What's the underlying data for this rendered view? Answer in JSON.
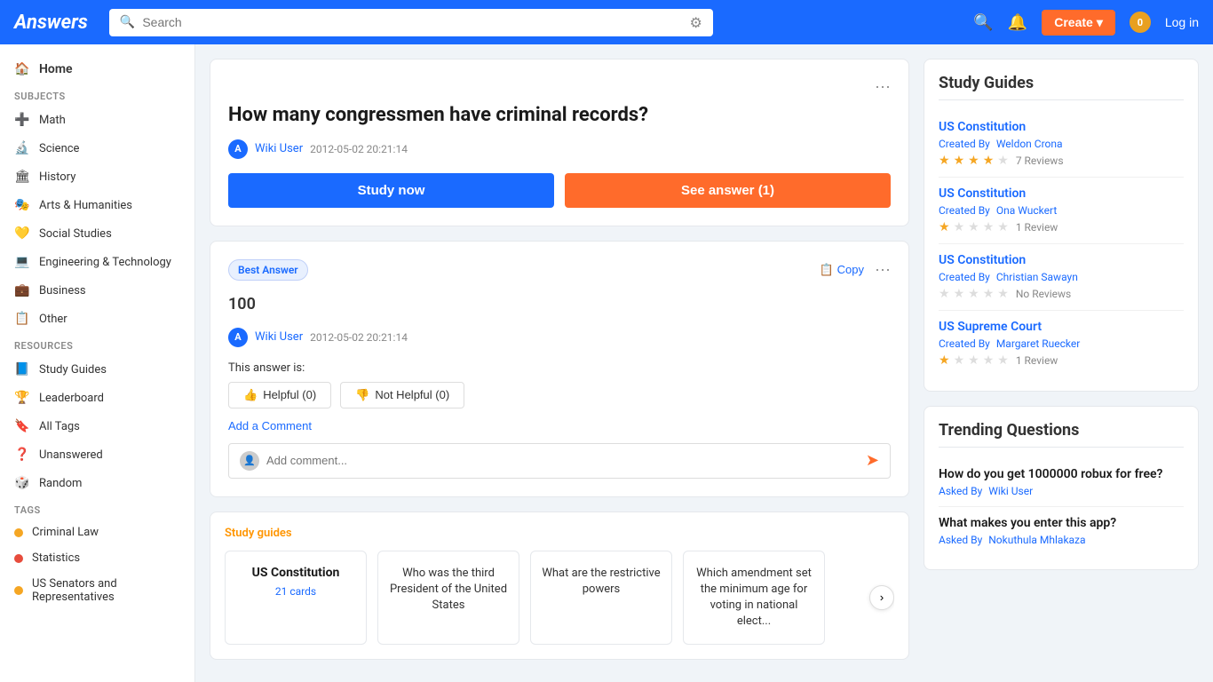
{
  "header": {
    "logo": "Answers",
    "search_placeholder": "Search",
    "create_label": "Create",
    "notifications_count": "0",
    "login_label": "Log in"
  },
  "sidebar": {
    "home_label": "Home",
    "subjects_label": "Subjects",
    "items": [
      {
        "id": "math",
        "label": "Math",
        "icon": "➕"
      },
      {
        "id": "science",
        "label": "Science",
        "icon": "🔬"
      },
      {
        "id": "history",
        "label": "History",
        "icon": "🏛"
      },
      {
        "id": "arts-humanities",
        "label": "Arts & Humanities",
        "icon": "🎭"
      },
      {
        "id": "social-studies",
        "label": "Social Studies",
        "icon": "💛"
      },
      {
        "id": "engineering-technology",
        "label": "Engineering & Technology",
        "icon": "💻"
      },
      {
        "id": "business",
        "label": "Business",
        "icon": "💼"
      },
      {
        "id": "other",
        "label": "Other",
        "icon": "📋"
      }
    ],
    "resources_label": "Resources",
    "resources": [
      {
        "id": "study-guides",
        "label": "Study Guides",
        "icon": "📘"
      },
      {
        "id": "leaderboard",
        "label": "Leaderboard",
        "icon": "🏆"
      },
      {
        "id": "all-tags",
        "label": "All Tags",
        "icon": "🔖"
      },
      {
        "id": "unanswered",
        "label": "Unanswered",
        "icon": "❓"
      },
      {
        "id": "random",
        "label": "Random",
        "icon": "🎲"
      }
    ],
    "tags_label": "Tags",
    "tags": [
      {
        "id": "criminal-law",
        "label": "Criminal Law",
        "color": "#f5a623"
      },
      {
        "id": "statistics",
        "label": "Statistics",
        "color": "#e74c3c"
      },
      {
        "id": "us-senators",
        "label": "US Senators and Representatives",
        "color": "#f5a623"
      }
    ]
  },
  "question": {
    "title": "How many congressmen have criminal records?",
    "user": "Wiki User",
    "timestamp": "2012-05-02 20:21:14",
    "study_now": "Study now",
    "see_answer": "See answer (1)"
  },
  "best_answer": {
    "badge": "Best Answer",
    "copy_label": "Copy",
    "answer_text": "100",
    "user": "Wiki User",
    "timestamp": "2012-05-02 20:21:14",
    "helpful_label": "This answer is:",
    "helpful_btn": "Helpful (0)",
    "not_helpful_btn": "Not Helpful (0)",
    "add_comment": "Add a Comment",
    "comment_placeholder": "Add comment..."
  },
  "study_guides_section": {
    "tag": "Study guides",
    "cards": [
      {
        "title": "US Constitution",
        "subtitle": "21 cards",
        "type": "title-cards"
      },
      {
        "title": "Who was the third President of the United States",
        "type": "text"
      },
      {
        "title": "What are the restrictive powers",
        "type": "text"
      },
      {
        "title": "Which amendment set the minimum age for voting in national elect...",
        "type": "text"
      }
    ]
  },
  "right_panel": {
    "study_guides_title": "Study Guides",
    "guides": [
      {
        "title": "US Constitution",
        "created_by": "Created By",
        "author": "Weldon Crona",
        "rating": 3.6,
        "stars": [
          true,
          true,
          true,
          true,
          false
        ],
        "reviews": "7 Reviews"
      },
      {
        "title": "US Constitution",
        "created_by": "Created By",
        "author": "Ona Wuckert",
        "rating": 1.0,
        "stars": [
          true,
          false,
          false,
          false,
          false
        ],
        "reviews": "1 Review"
      },
      {
        "title": "US Constitution",
        "created_by": "Created By",
        "author": "Christian Sawayn",
        "rating": 0,
        "stars": [
          false,
          false,
          false,
          false,
          false
        ],
        "reviews": "No Reviews"
      },
      {
        "title": "US Supreme Court",
        "created_by": "Created By",
        "author": "Margaret Ruecker",
        "rating": 1.0,
        "stars": [
          true,
          false,
          false,
          false,
          false
        ],
        "reviews": "1 Review"
      }
    ],
    "trending_title": "Trending Questions",
    "trending": [
      {
        "question": "How do you get 1000000 robux for free?",
        "asked_by": "Asked By",
        "user": "Wiki User"
      },
      {
        "question": "What makes you enter this app?",
        "asked_by": "Asked By",
        "user": "Nokuthula Mhlakaza"
      }
    ]
  }
}
